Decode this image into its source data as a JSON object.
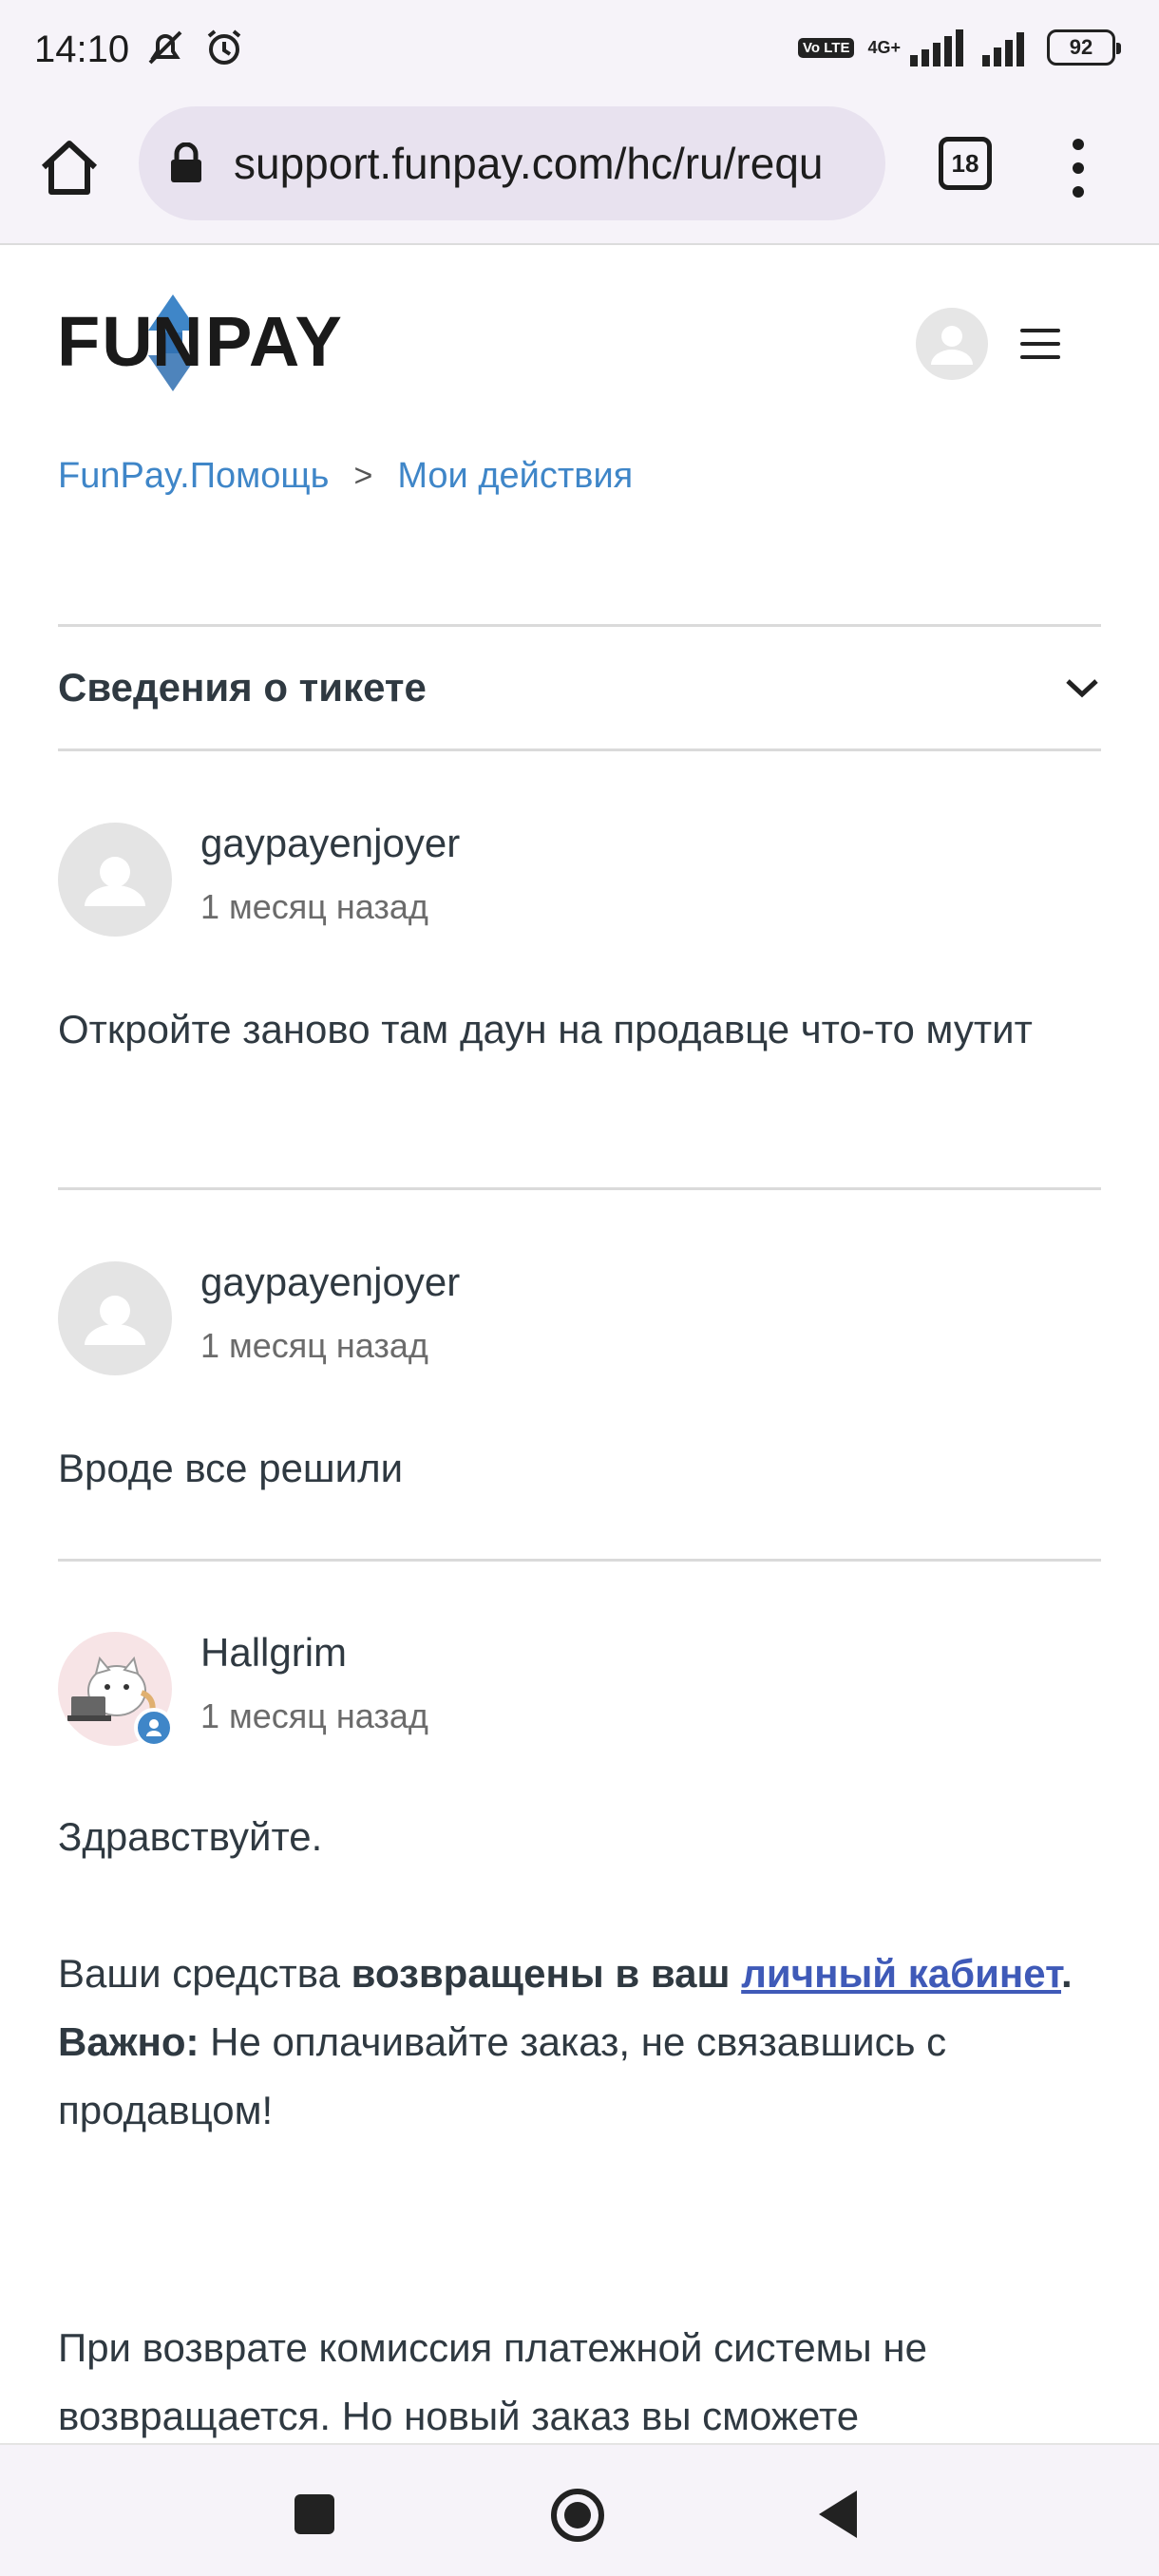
{
  "status_bar": {
    "time": "14:10",
    "network_type": "4G+",
    "volte": "Vo LTE",
    "battery": "92"
  },
  "browser": {
    "url": "support.funpay.com/hc/ru/requ",
    "tab_count": "18"
  },
  "header": {
    "logo_text": "FUNPAY"
  },
  "breadcrumb": {
    "items": [
      "FunPay.Помощь",
      "Мои действия"
    ],
    "separator": ">"
  },
  "ticket_info": {
    "title": "Сведения о тикете"
  },
  "comments": [
    {
      "author": "gaypayenjoyer",
      "date": "1 месяц назад",
      "body": "Откройте заново там даун на продавце что-то мутит"
    },
    {
      "author": "gaypayenjoyer",
      "date": "1 месяц назад",
      "body": "Вроде все решили"
    },
    {
      "author": "Hallgrim",
      "date": "1 месяц назад",
      "greeting": "Здравствуйте.",
      "p1_start": "Ваши средства ",
      "p1_bold": "возвращены в ваш",
      "p1_space": " ",
      "p1_link": "личный кабинет",
      "p1_end": ".",
      "p2_bold": "Важно:",
      "p2_text": " Не оплачивайте заказ, не связавшись с продавцом!",
      "p3_text": "При возврате комиссия платежной системы не возвращается. Но новый заказ вы сможете"
    }
  ],
  "colors": {
    "link": "#3f86c8",
    "body_link": "#3f5ab8",
    "logo_blue": "#3f86c8",
    "text": "#2f3941"
  }
}
